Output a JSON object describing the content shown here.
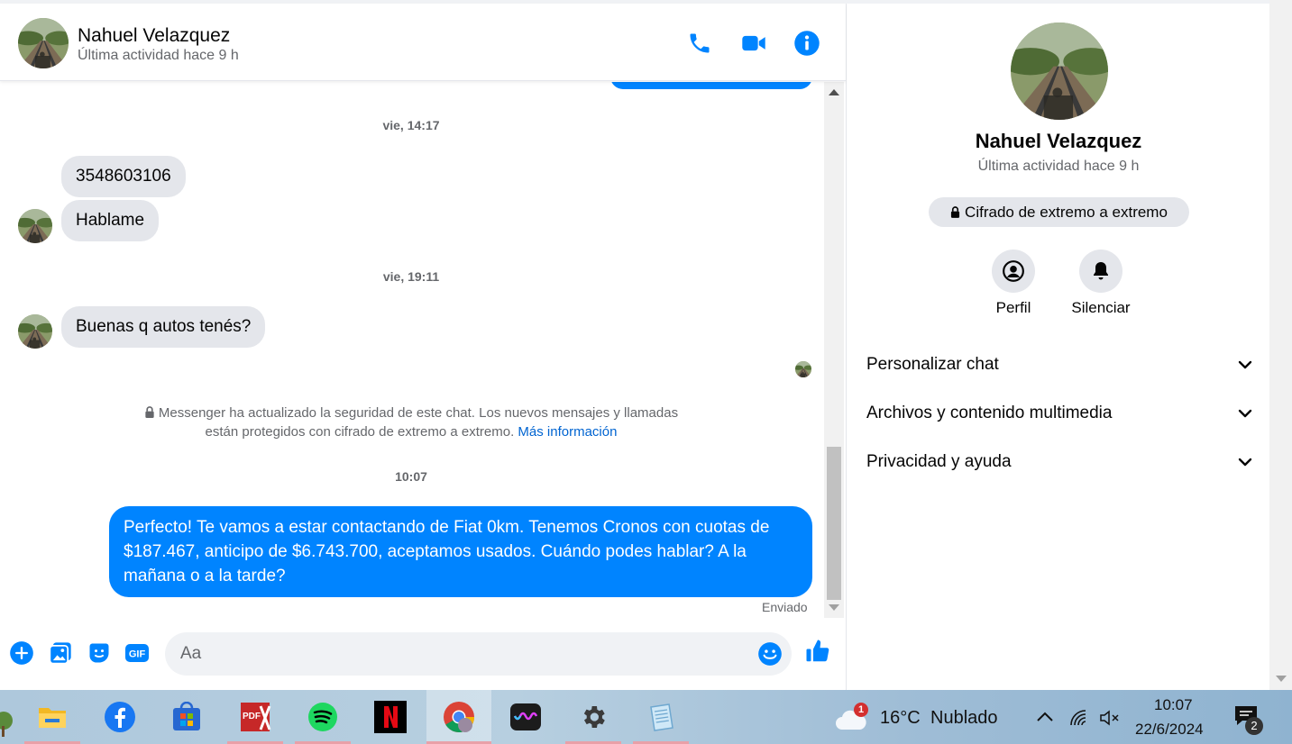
{
  "contact": {
    "name": "Nahuel Velazquez",
    "status": "Última actividad hace 9 h"
  },
  "messages": {
    "timestamp_1": "vie, 14:17",
    "msg_1": "3548603106",
    "msg_2": "Hablame",
    "timestamp_2": "vie, 19:11",
    "msg_3": "Buenas q autos tenés?",
    "security_note": "Messenger ha actualizado la seguridad de este chat. Los nuevos mensajes y llamadas están protegidos con cifrado de extremo a extremo.",
    "security_link": "Más información",
    "timestamp_3": "10:07",
    "msg_out": "Perfecto! Te vamos a estar contactando de Fiat 0km. Tenemos Cronos con cuotas de $187.467, anticipo de $6.743.700, aceptamos usados. Cuándo podes hablar? A la mañana o a la tarde?",
    "sent_label": "Enviado"
  },
  "composer": {
    "placeholder": "Aa"
  },
  "info_panel": {
    "e2e_label": "Cifrado de extremo a extremo",
    "profile_label": "Perfil",
    "mute_label": "Silenciar",
    "sections": [
      "Personalizar chat",
      "Archivos y contenido multimedia",
      "Privacidad y ayuda"
    ]
  },
  "taskbar": {
    "weather_temp": "16°C",
    "weather_desc": "Nublado",
    "weather_badge": "1",
    "time": "10:07",
    "date": "22/6/2024",
    "notif_count": "2"
  },
  "colors": {
    "messenger_blue": "#0084ff",
    "bubble_gray": "#e4e6eb",
    "secondary_text": "#65676b"
  }
}
